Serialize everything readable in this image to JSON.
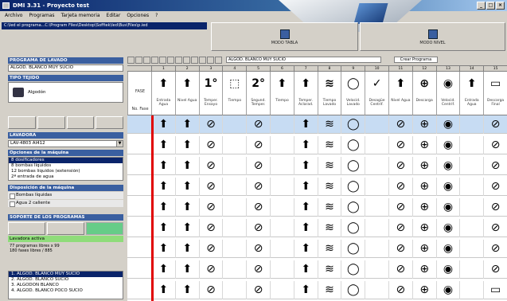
{
  "window": {
    "title": "DMI 3.31 - Proyecto test"
  },
  "window_controls": [
    "_",
    "□",
    "×"
  ],
  "menu": [
    "Archivo",
    "Programas",
    "Tarjeta memoria",
    "Editar",
    "Opciones",
    "?"
  ],
  "path_bar": "C:\\Ied el programa...C:\\Program Files\\Desktop\\Sofftek\\Ied\\Bus\\Files\\p.ied",
  "top_buttons": [
    {
      "label": "MODO TABLA"
    },
    {
      "label": "MODO NIVEL"
    }
  ],
  "left": {
    "program_header": "PROGRAMA DE LAVADO",
    "program_name": "ALGOD. BLANCO MUY SUCIO",
    "fabric_header": "TIPO TEJIDO",
    "fabric_value": "Algodón",
    "washer_header": "LAVADORA",
    "washer_value": "LAV-4803 AI412",
    "machine_header": "Opciones de la máquina",
    "machine_options": [
      "8 dosificadores",
      "8 bombas líquidos",
      "12 bombas líquidos (extensión)",
      "2ª entrada de agua"
    ],
    "machine_selected_index": 0,
    "disp_header": "Disposición de la máquina",
    "disp_options": [
      "Bombas líquidas",
      "Agua 2 caliente"
    ],
    "support_header": "SOPORTE DE LOS PROGRAMAS",
    "washer_active": "Lavadora activa",
    "info_lines": [
      "77 programas libres x 99",
      "180 fases libres / 885"
    ],
    "program_list": [
      "1. ALGOD. BLANCO MUY SUCIO",
      "2. ALGOD. BLANCO SUCIO",
      "3. ALGODON BLANCO",
      "4. ALGOD. BLANCO POCO SUCIO"
    ],
    "program_list_selected": 0
  },
  "right": {
    "toolbar_text": "ALGOD. BLANCO MUY SUCIO",
    "toolbar_button": "Crear Programa",
    "fase_label": "FASE",
    "no_label": "No. Fase",
    "columns": [
      {
        "num": "1",
        "symbol": "⬆",
        "caption": "Entrada Agua"
      },
      {
        "num": "2",
        "symbol": "⬆",
        "caption": "Nivel Agua"
      },
      {
        "num": "3",
        "symbol": "1°",
        "caption": "Temper. Ensayo"
      },
      {
        "num": "4",
        "symbol": "⬚",
        "caption": "Tiempo"
      },
      {
        "num": "5",
        "symbol": "2°",
        "caption": "Segund. Temper."
      },
      {
        "num": "6",
        "symbol": "⬆",
        "caption": "Tiempo"
      },
      {
        "num": "7",
        "symbol": "⬆",
        "caption": "Temper. Aclarad."
      },
      {
        "num": "8",
        "symbol": "≋",
        "caption": "Tiempo Lavado"
      },
      {
        "num": "9",
        "symbol": "◯",
        "caption": "Velocid. Lavado"
      },
      {
        "num": "10",
        "symbol": "✓",
        "caption": "Desagüe Centrif."
      },
      {
        "num": "11",
        "symbol": "⬆",
        "caption": "Nivel Agua"
      },
      {
        "num": "12",
        "symbol": "⊕",
        "caption": "Descarga"
      },
      {
        "num": "13",
        "symbol": "◉",
        "caption": "Velocid. Centrif."
      },
      {
        "num": "14",
        "symbol": "⬆",
        "caption": "Entrada Agua"
      },
      {
        "num": "15",
        "symbol": "▭",
        "caption": "Descarga Final"
      }
    ],
    "rows": [
      [
        "⬆",
        "⬆",
        "⊘",
        "",
        "⊘",
        "",
        "⬆",
        "≋",
        "◯",
        "",
        "⊘",
        "⊕",
        "◉",
        "",
        "⊘"
      ],
      [
        "⬆",
        "⬆",
        "⊘",
        "",
        "⊘",
        "",
        "⬆",
        "≋",
        "◯",
        "",
        "⊘",
        "⊕",
        "◉",
        "",
        "⊘"
      ],
      [
        "⬆",
        "⬆",
        "⊘",
        "",
        "⊘",
        "",
        "⬆",
        "≋",
        "◯",
        "",
        "⊘",
        "⊕",
        "◉",
        "",
        "⊘"
      ],
      [
        "⬆",
        "⬆",
        "⊘",
        "",
        "⊘",
        "",
        "⬆",
        "≋",
        "◯",
        "",
        "⊘",
        "⊕",
        "◉",
        "",
        "⊘"
      ],
      [
        "⬆",
        "⬆",
        "⊘",
        "",
        "⊘",
        "",
        "⬆",
        "≋",
        "◯",
        "",
        "⊘",
        "⊕",
        "◉",
        "",
        "⊘"
      ],
      [
        "⬆",
        "⬆",
        "⊘",
        "",
        "⊘",
        "",
        "⬆",
        "≋",
        "◯",
        "",
        "⊘",
        "⊕",
        "◉",
        "",
        "⊘"
      ],
      [
        "⬆",
        "⬆",
        "⊘",
        "",
        "⊘",
        "",
        "⬆",
        "≋",
        "◯",
        "",
        "⊘",
        "⊕",
        "◉",
        "",
        "⊘"
      ],
      [
        "⬆",
        "⬆",
        "⊘",
        "",
        "⊘",
        "",
        "⬆",
        "≋",
        "◯",
        "",
        "⊘",
        "⊕",
        "◉",
        "",
        "⊘"
      ],
      [
        "⬆",
        "⬆",
        "⊘",
        "",
        "⊘",
        "",
        "⬆",
        "≋",
        "◯",
        "",
        "⊘",
        "⊕",
        "◉",
        "",
        "▭"
      ]
    ],
    "selected_row": 0
  }
}
